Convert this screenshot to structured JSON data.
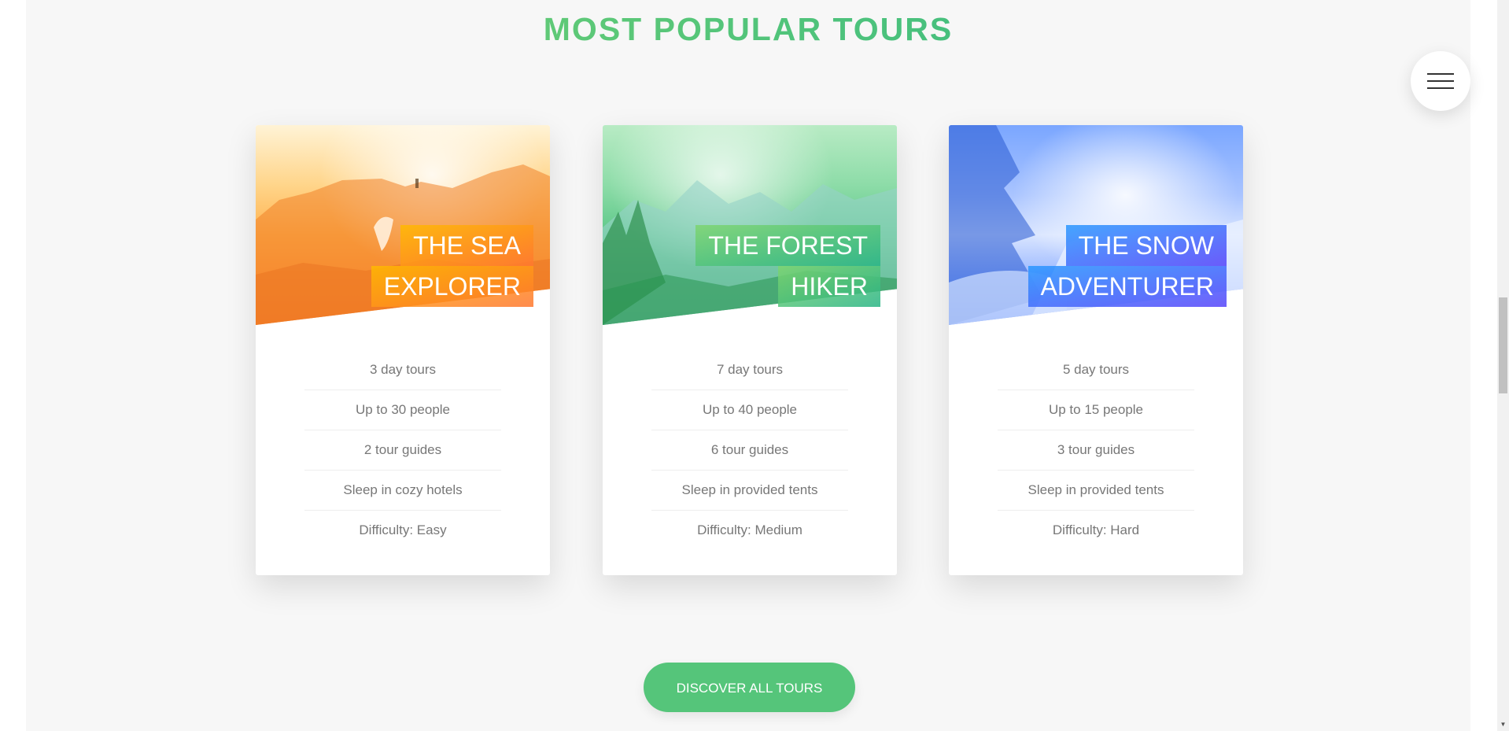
{
  "section": {
    "title": "MOST POPULAR TOURS"
  },
  "navigation": {
    "menu_icon": "hamburger-menu-icon"
  },
  "cards": [
    {
      "heading_line1": "THE SEA",
      "heading_line2": "EXPLORER",
      "theme": "orange",
      "colors": [
        "#ffb900",
        "#ff7730"
      ],
      "details": [
        "3 day tours",
        "Up to 30 people",
        "2 tour guides",
        "Sleep in cozy hotels",
        "Difficulty: Easy"
      ]
    },
    {
      "heading_line1": "THE FOREST",
      "heading_line2": "HIKER",
      "theme": "green",
      "colors": [
        "#7ed56f",
        "#28b485"
      ],
      "details": [
        "7 day tours",
        "Up to 40 people",
        "6 tour guides",
        "Sleep in provided tents",
        "Difficulty: Medium"
      ]
    },
    {
      "heading_line1": "THE SNOW",
      "heading_line2": "ADVENTURER",
      "theme": "blue",
      "colors": [
        "#2998ff",
        "#5643fa"
      ],
      "details": [
        "5 day tours",
        "Up to 15 people",
        "3 tour guides",
        "Sleep in provided tents",
        "Difficulty: Hard"
      ]
    }
  ],
  "cta": {
    "label": "DISCOVER ALL TOURS",
    "color": "#55c57a"
  },
  "scrollbar": {
    "down_arrow_icon": "scroll-down-arrow-icon"
  }
}
